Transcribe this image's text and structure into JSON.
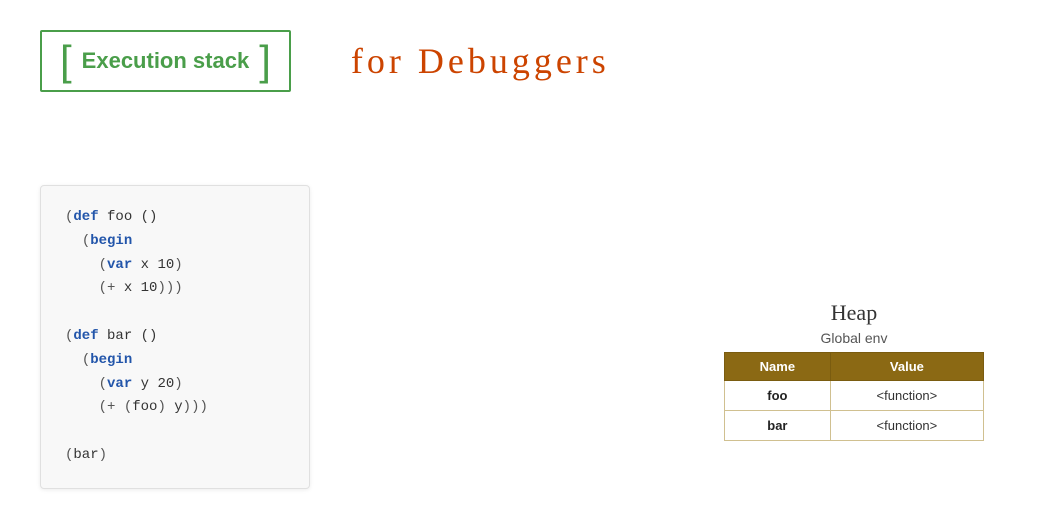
{
  "header": {
    "execution_stack_label": "Execution stack",
    "handwritten_text": "for  Debuggers"
  },
  "code": {
    "lines": [
      "(def foo ()",
      "  (begin",
      "    (var x 10)",
      "    (+ x 10)))",
      "",
      "(def bar ()",
      "  (begin",
      "    (var y 20)",
      "    (+ (foo) y)))",
      "",
      "(bar)"
    ]
  },
  "heap": {
    "title": "Heap",
    "subtitle": "Global env",
    "columns": [
      "Name",
      "Value"
    ],
    "rows": [
      {
        "name": "foo",
        "value": "<function>"
      },
      {
        "name": "bar",
        "value": "<function>"
      }
    ]
  }
}
